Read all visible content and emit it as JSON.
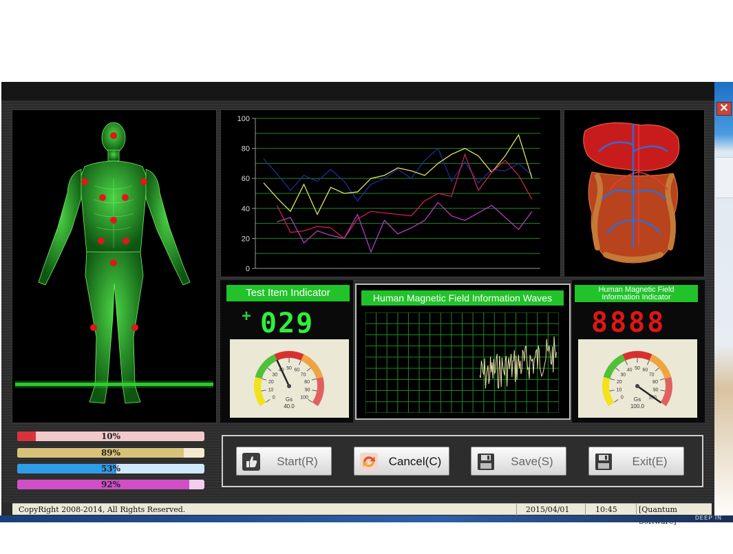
{
  "window": {
    "close_symbol": "✕"
  },
  "chart_data": {
    "type": "line",
    "x": [
      1,
      2,
      3,
      4,
      5,
      6,
      7,
      8,
      9,
      10,
      11,
      12,
      13,
      14,
      15,
      16,
      17,
      18,
      19,
      20,
      21
    ],
    "ylim": [
      0,
      100
    ],
    "yticks": [
      "0",
      "20",
      "40",
      "60",
      "80",
      "100"
    ],
    "grid": true,
    "series": [
      {
        "color": "#1e2f9c",
        "values": [
          73,
          63,
          52,
          62,
          58,
          66,
          58,
          45,
          56,
          60,
          66,
          60,
          72,
          80,
          58,
          71,
          57,
          66,
          65,
          70,
          62
        ]
      },
      {
        "color": "#e4e460",
        "values": [
          57,
          47,
          38,
          56,
          36,
          54,
          50,
          51,
          60,
          62,
          67,
          65,
          62,
          70,
          76,
          80,
          75,
          64,
          75,
          89,
          60
        ]
      },
      {
        "color": "#d0204c",
        "values": [
          null,
          42,
          24,
          25,
          28,
          27,
          20,
          33,
          38,
          37,
          36,
          35,
          45,
          50,
          48,
          76,
          52,
          64,
          72,
          62,
          46
        ]
      },
      {
        "color": "#b43cc0",
        "values": [
          null,
          31,
          34,
          17,
          25,
          22,
          20,
          36,
          11,
          32,
          23,
          27,
          32,
          44,
          35,
          32,
          37,
          42,
          34,
          26,
          38
        ]
      }
    ]
  },
  "indicator_left": {
    "title": "Test Item Indicator",
    "sign": "+",
    "digits": "029",
    "gauge": {
      "ticks": [
        "0",
        "10",
        "20",
        "30",
        "40",
        "50",
        "60",
        "70",
        "80",
        "90",
        "100"
      ],
      "unit": "Gs",
      "value_text": "40.0",
      "value": 40.0
    }
  },
  "waves": {
    "title": "Human Magnetic Field Information Waves"
  },
  "indicator_right": {
    "title_line1": "Human Magnetic Field",
    "title_line2": "Information Indicator",
    "digits": "8888",
    "gauge": {
      "ticks": [
        "0",
        "10",
        "20",
        "30",
        "40",
        "50",
        "60",
        "70",
        "80",
        "90",
        "100"
      ],
      "unit": "Gs",
      "value_text": "100.0",
      "value": 100.0
    }
  },
  "progress": [
    {
      "label": "10%",
      "value": 0.1,
      "color": "#d9323a",
      "track": "#f2c9cb"
    },
    {
      "label": "89%",
      "value": 0.89,
      "color": "#d8c27a",
      "track": "#f3ead0"
    },
    {
      "label": "53%",
      "value": 0.53,
      "color": "#2f9ce8",
      "track": "#cfe8fb"
    },
    {
      "label": "92%",
      "value": 0.92,
      "color": "#d04fc7",
      "track": "#f3cdef"
    }
  ],
  "buttons": {
    "start": "Start(R)",
    "cancel": "Cancel(C)",
    "save": "Save(S)",
    "exit": "Exit(E)"
  },
  "status": {
    "copyright": "CopyRight 2008-2014, All Rights Reserved.",
    "date": "2015/04/01",
    "time": "10:45",
    "app": "[Quantum Software]"
  },
  "taskbar": {
    "brand": "DEEP IN"
  }
}
